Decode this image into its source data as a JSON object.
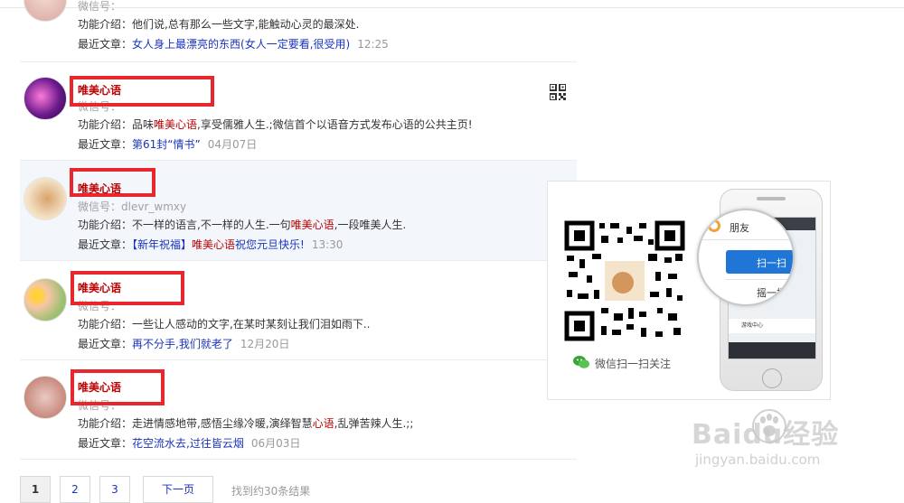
{
  "results": [
    {
      "name": "",
      "wxid_prefix": "微信号：",
      "wxid": "",
      "intro_label": "功能介绍：",
      "intro_parts": [
        "他们说,总有那么一些文字,能触动心灵的最深处."
      ],
      "recent_label": "最近文章：",
      "recent_parts": [
        "女人身上最漂亮的东西(女人一定要看,很受用)"
      ],
      "recent_time": "12:25"
    },
    {
      "name": "唯美心语",
      "wxid_prefix": "微信号：",
      "wxid": "",
      "intro_label": "功能介绍：",
      "intro_parts": [
        "品味",
        "唯美心语",
        ",享受儒雅人生.;微信首个以语音方式发布心语的公共主页!"
      ],
      "recent_label": "最近文章：",
      "recent_parts": [
        "第61封“情书”"
      ],
      "recent_time": "04月07日"
    },
    {
      "name": "唯美心语",
      "wxid_prefix": "微信号：",
      "wxid": "dlevr_wmxy",
      "intro_label": "功能介绍：",
      "intro_parts": [
        "不一样的语言,不一样的人生.一句",
        "唯美心语",
        ",一段唯美人生."
      ],
      "recent_label": "最近文章：",
      "recent_parts": [
        "【新年祝福】",
        "唯美心语",
        "祝您元旦快乐!"
      ],
      "recent_time": "13:30"
    },
    {
      "name": "唯美心语",
      "wxid_prefix": "微信号：",
      "wxid": "",
      "intro_label": "功能介绍：",
      "intro_parts": [
        "一些让人感动的文字,在某时某刻让我们泪如雨下.."
      ],
      "recent_label": "最近文章：",
      "recent_parts": [
        "再不分手,我们就老了"
      ],
      "recent_time": "12月20日"
    },
    {
      "name": "唯美心语",
      "wxid_prefix": "微信号：",
      "wxid": "",
      "intro_label": "功能介绍：",
      "intro_parts": [
        "走进情感地带,感悟尘缘冷暖,演绎智慧",
        "心语",
        ",乱弹苦辣人生.;;"
      ],
      "recent_label": "最近文章：",
      "recent_parts": [
        "花空流水去,过往皆云烟"
      ],
      "recent_time": "06月03日"
    }
  ],
  "popup": {
    "scan_text": "微信扫一扫关注",
    "phone_menu": [
      "朋友",
      "扫一扫",
      "摇一摇",
      "游戏中心"
    ]
  },
  "pagination": {
    "pages": [
      "1",
      "2",
      "3"
    ],
    "next_label": "下一页",
    "found_text": "找到约30条结果"
  },
  "watermark": {
    "brand": "Baidu经验",
    "url": "jingyan.baidu.com"
  },
  "colors": {
    "name_red": "#c00000",
    "link_blue": "#1a33bb",
    "annotation_red": "#e8262e",
    "highlight_bg": "#f3f7fc"
  }
}
